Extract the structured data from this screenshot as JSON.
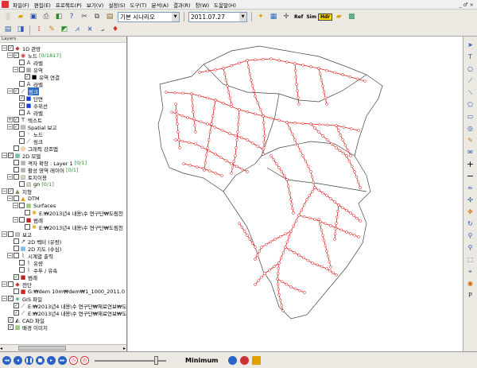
{
  "menu": {
    "items": [
      "파일(F)",
      "편집(E)",
      "프로젝트(P)",
      "보기(V)",
      "설정(S)",
      "도구(T)",
      "분석(A)",
      "결과(R)",
      "창(W)",
      "도움말(H)"
    ],
    "window_controls": "_ ♂ ×"
  },
  "toolbar": {
    "scenario_value": "기본 시나리오",
    "date_value": "2011.07.27",
    "ref_label": "Ref",
    "sim_label": "Sim",
    "hdr_label": "Hdr"
  },
  "panel": {
    "title": "Layers",
    "rows": [
      {
        "label": "1D 관망",
        "count": "",
        "level": 1,
        "exp": "−",
        "chk": true,
        "icon": "◆",
        "color": "#c33"
      },
      {
        "label": "노드",
        "count": "[0/1817]",
        "level": 2,
        "exp": "−",
        "chk": true,
        "icon": "◉",
        "color": "#c33"
      },
      {
        "label": "라벨",
        "count": "",
        "level": 3,
        "exp": "",
        "chk": false,
        "icon": "A",
        "color": "#333"
      },
      {
        "label": "유역",
        "count": "",
        "level": 3,
        "exp": "−",
        "chk": false,
        "icon": "▦",
        "color": "#777"
      },
      {
        "label": "유역 연결",
        "count": "",
        "level": 4,
        "exp": "",
        "chk": true,
        "icon": "■",
        "color": "#000"
      },
      {
        "label": "라벨",
        "count": "",
        "level": 3,
        "exp": "",
        "chk": false,
        "icon": "A",
        "color": "#333"
      },
      {
        "label": "링크",
        "count": "",
        "level": 2,
        "exp": "−",
        "chk": true,
        "icon": "⟋",
        "color": "#444",
        "selected": true
      },
      {
        "label": "단면",
        "count": "",
        "level": 3,
        "exp": "",
        "chk": true,
        "icon": "■",
        "color": "#1a3ccf"
      },
      {
        "label": "수위선",
        "count": "",
        "level": 3,
        "exp": "",
        "chk": true,
        "icon": "■",
        "color": "#1a3ccf"
      },
      {
        "label": "라벨",
        "count": "",
        "level": 3,
        "exp": "",
        "chk": false,
        "icon": "A",
        "color": "#333"
      },
      {
        "label": "텍스트",
        "count": "",
        "level": 2,
        "exp": "+",
        "chk": true,
        "icon": "T",
        "color": "#333"
      },
      {
        "label": "Spatial 보고",
        "count": "",
        "level": 2,
        "exp": "−",
        "chk": true,
        "icon": "▤",
        "color": "#555"
      },
      {
        "label": "노드",
        "count": "",
        "level": 3,
        "exp": "",
        "chk": false,
        "icon": "◦",
        "color": "#333"
      },
      {
        "label": "링크",
        "count": "",
        "level": 3,
        "exp": "",
        "chk": false,
        "icon": "⟋",
        "color": "#333"
      },
      {
        "label": "그래픽 강조맵",
        "count": "",
        "level": 2,
        "exp": "",
        "chk": false,
        "icon": "◎",
        "color": "#c60"
      },
      {
        "label": "2D 모델",
        "count": "",
        "level": 1,
        "exp": "−",
        "chk": true,
        "icon": "▦",
        "color": "#397"
      },
      {
        "label": "격자 확장 : Layer 1",
        "count": "[0/1]",
        "level": 2,
        "exp": "",
        "chk": false,
        "icon": "▦",
        "color": "#888"
      },
      {
        "label": "활성 영역 레이어",
        "count": "[0/1]",
        "level": 2,
        "exp": "",
        "chk": false,
        "icon": "▦",
        "color": "#888"
      },
      {
        "label": "토지이용",
        "count": "",
        "level": 2,
        "exp": "−",
        "chk": false,
        "icon": "▧",
        "color": "#886"
      },
      {
        "label": "gn",
        "count": "[0/1]",
        "level": 3,
        "exp": "",
        "chk": false,
        "icon": "▧",
        "color": "#886"
      },
      {
        "label": "지형",
        "count": "",
        "level": 1,
        "exp": "−",
        "chk": true,
        "icon": "▲",
        "color": "#884"
      },
      {
        "label": "DTM",
        "count": "",
        "level": 2,
        "exp": "−",
        "chk": false,
        "icon": "▲",
        "color": "#e90"
      },
      {
        "label": "Surfaces",
        "count": "",
        "level": 3,
        "exp": "−",
        "chk": false,
        "icon": "▦",
        "color": "#6a4"
      },
      {
        "label": "E:₩2013년4 내용\\수 연구단₩도림천",
        "count": "",
        "level": 4,
        "exp": "",
        "chk": false,
        "icon": "✱",
        "color": "#da2"
      },
      {
        "label": "범례",
        "count": "",
        "level": 3,
        "exp": "−",
        "chk": false,
        "icon": "■",
        "color": "#b22"
      },
      {
        "label": "E:₩2013년4 내용\\수 연구단₩도림천",
        "count": "",
        "level": 4,
        "exp": "",
        "chk": false,
        "icon": "✱",
        "color": "#da2"
      },
      {
        "label": "보고",
        "count": "",
        "level": 1,
        "exp": "−",
        "chk": false,
        "icon": "▤",
        "color": "#555"
      },
      {
        "label": "2D 벡터 (유량)",
        "count": "",
        "level": 2,
        "exp": "",
        "chk": false,
        "icon": "↗",
        "color": "#333"
      },
      {
        "label": "2D 지도 (수심)",
        "count": "",
        "level": 2,
        "exp": "",
        "chk": false,
        "icon": "▦",
        "color": "#39c"
      },
      {
        "label": "시계열 출력",
        "count": "",
        "level": 2,
        "exp": "−",
        "chk": false,
        "icon": "⌇",
        "color": "#333"
      },
      {
        "label": "유량",
        "count": "",
        "level": 3,
        "exp": "",
        "chk": false,
        "icon": "⌇",
        "color": "#333"
      },
      {
        "label": "수두 / 유속",
        "count": "",
        "level": 3,
        "exp": "",
        "chk": false,
        "icon": "⌇",
        "color": "#333"
      },
      {
        "label": "범례",
        "count": "",
        "level": 2,
        "exp": "",
        "chk": true,
        "icon": "■",
        "color": "#b22"
      },
      {
        "label": "전단",
        "count": "",
        "level": 1,
        "exp": "−",
        "chk": false,
        "icon": "◆",
        "color": "#c33"
      },
      {
        "label": "G:₩dem 10m₩dem₩1_1000_2011.0",
        "count": "",
        "level": 2,
        "exp": "",
        "chk": false,
        "icon": "■",
        "color": "#c22"
      },
      {
        "label": "GIS 파일",
        "count": "",
        "level": 1,
        "exp": "−",
        "chk": true,
        "icon": "◈",
        "color": "#2a7"
      },
      {
        "label": "E:₩2013년4 내용\\수 연구단₩재료연보₩도",
        "count": "",
        "level": 2,
        "exp": "",
        "chk": true,
        "icon": "⟋",
        "color": "#333"
      },
      {
        "label": "E:₩2013년4 내용\\수 연구단₩재료연보₩도",
        "count": "",
        "level": 2,
        "exp": "",
        "chk": true,
        "icon": "⟋",
        "color": "#333"
      },
      {
        "label": "CAD 파일",
        "count": "",
        "level": 1,
        "exp": "",
        "chk": true,
        "icon": "◭",
        "color": "#333"
      },
      {
        "label": "배경 이미지",
        "count": "",
        "level": 1,
        "exp": "",
        "chk": true,
        "icon": "▩",
        "color": "#6a4"
      }
    ]
  },
  "status": {
    "zoom_label": "Minimum",
    "slider_value": 0.88
  },
  "colors": {
    "network": "#e01818",
    "boundary": "#444444",
    "selection": "#316ac5"
  }
}
